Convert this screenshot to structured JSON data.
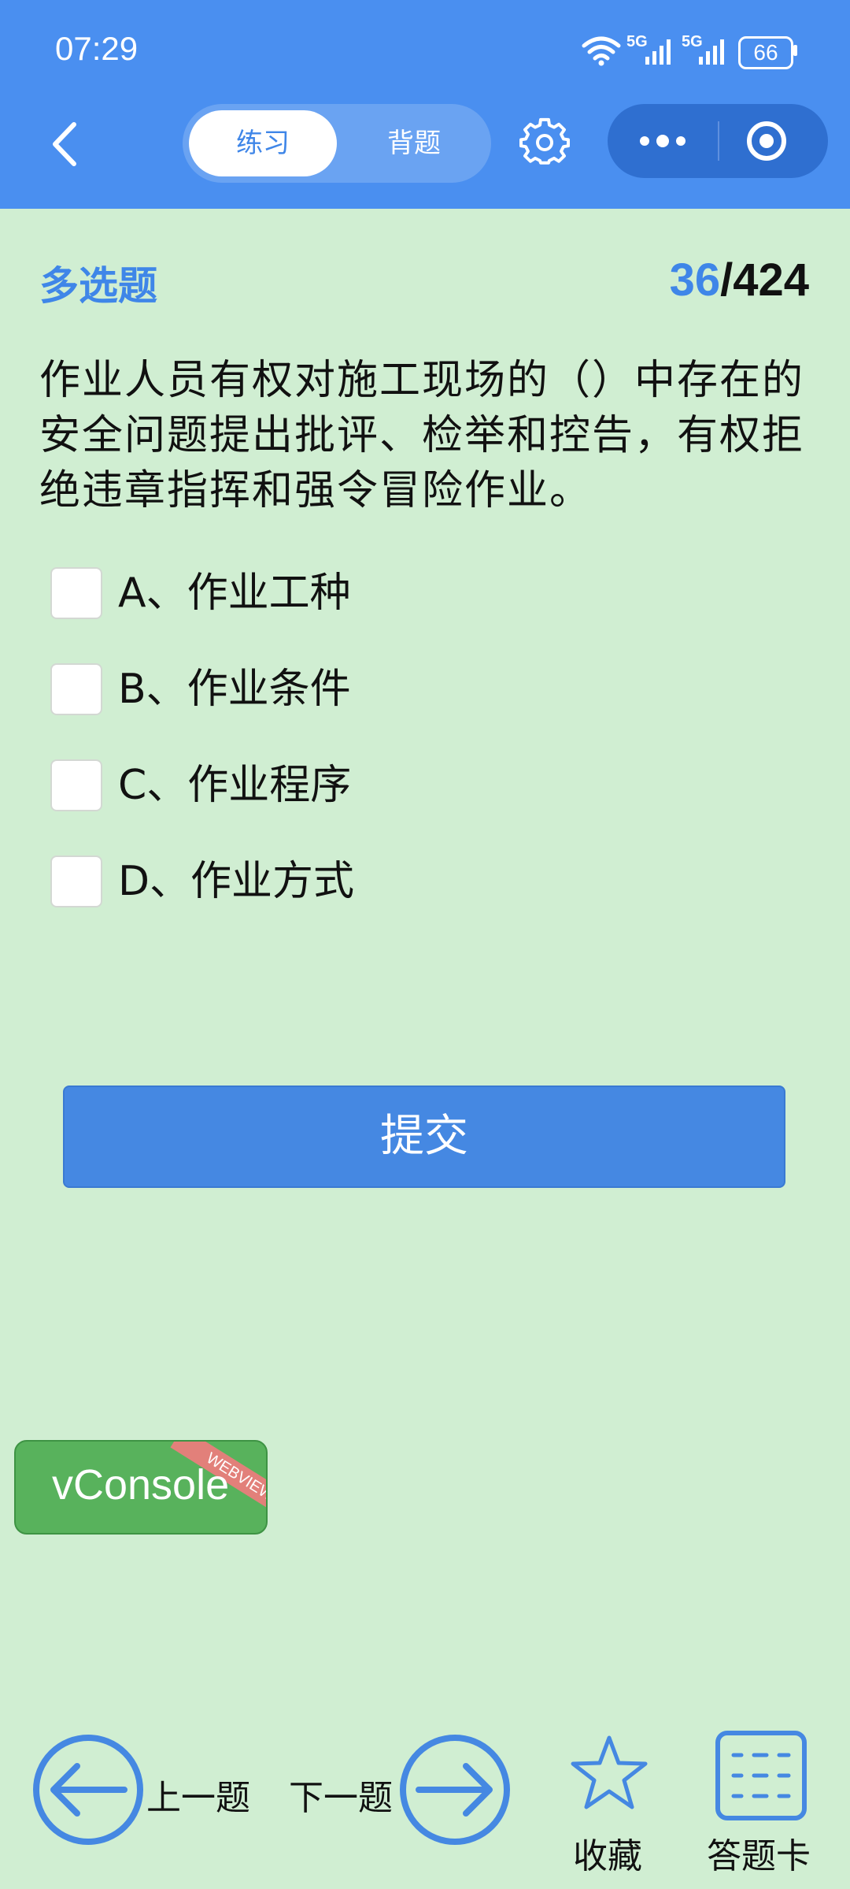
{
  "status_bar": {
    "time": "07:29",
    "battery": "66",
    "network_1": "5G",
    "network_2": "5G"
  },
  "header": {
    "tabs": [
      {
        "label": "练习",
        "active": true
      },
      {
        "label": "背题",
        "active": false
      }
    ]
  },
  "question": {
    "type": "多选题",
    "current": "36",
    "total": "/424",
    "text": "作业人员有权对施工现场的（）中存在的安全问题提出批评、检举和控告，有权拒绝违章指挥和强令冒险作业。",
    "options": [
      {
        "label": "A、作业工种",
        "checked": false
      },
      {
        "label": "B、作业条件",
        "checked": false
      },
      {
        "label": "C、作业程序",
        "checked": false
      },
      {
        "label": "D、作业方式",
        "checked": false
      }
    ]
  },
  "submit_label": "提交",
  "vconsole": {
    "label": "vConsole",
    "ribbon": "WEBVIEW"
  },
  "bottom_nav": {
    "prev": "上一题",
    "next": "下一题",
    "favorite": "收藏",
    "answer_card": "答题卡"
  },
  "colors": {
    "header": "#4a8ff0",
    "accent": "#3f86e8",
    "page_bg": "#d0eed2",
    "submit": "#4588e2",
    "vconsole": "#58b25c"
  }
}
